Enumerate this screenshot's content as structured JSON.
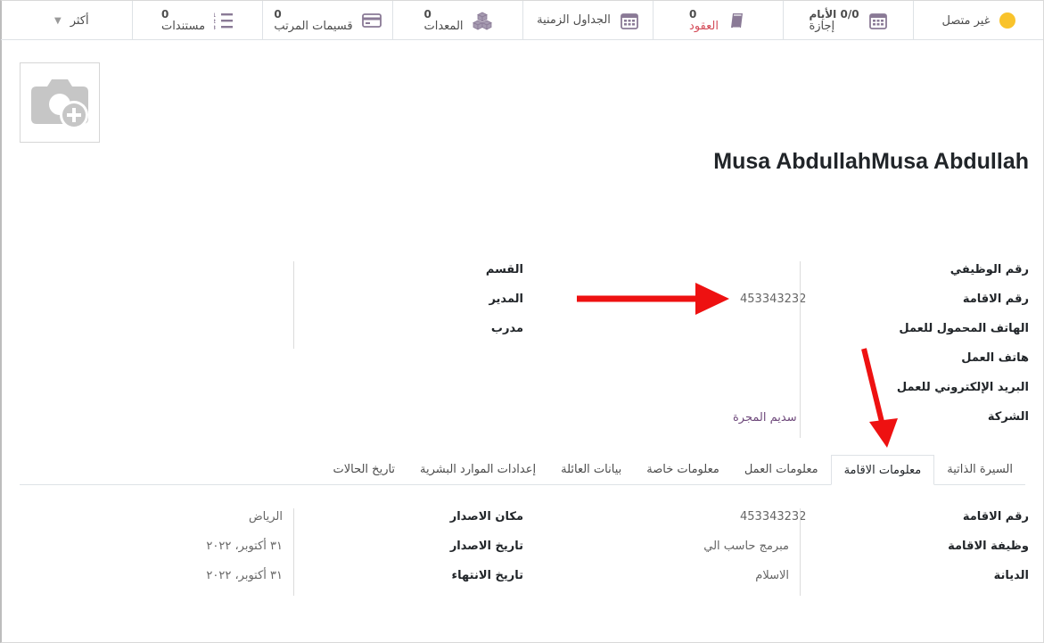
{
  "statbar": {
    "status": {
      "label": "غير متصل",
      "color": "#f9c32b"
    },
    "leave": {
      "num": "0/0 الأيام",
      "label": "إجازة"
    },
    "contracts": {
      "num": "0",
      "label": "العقود",
      "label_color": "#d44c59"
    },
    "timesheets": {
      "label": "الجداول الزمنية"
    },
    "equipment": {
      "num": "0",
      "label": "المعدات"
    },
    "payslips": {
      "num": "0",
      "label": "قسيمات المرتب"
    },
    "documents": {
      "num": "0",
      "label": "مستندات"
    },
    "more": {
      "label": "أكثر"
    }
  },
  "employee": {
    "name": "Musa AbdullahMusa Abdullah"
  },
  "info": {
    "right": [
      {
        "label": "رقم الوظيفي",
        "value": ""
      },
      {
        "label": "رقم الاقامة",
        "value": "453343232"
      },
      {
        "label": "الهاتف المحمول للعمل",
        "value": ""
      },
      {
        "label": "هاتف العمل",
        "value": ""
      },
      {
        "label": "البريد الإلكتروني للعمل",
        "value": ""
      },
      {
        "label": "الشركة",
        "value": "سديم المجرة"
      }
    ],
    "left": [
      {
        "label": "القسم",
        "value": ""
      },
      {
        "label": "المدير",
        "value": ""
      },
      {
        "label": "مدرب",
        "value": ""
      }
    ]
  },
  "tabs": [
    {
      "label": "السيرة الذاتية",
      "active": false
    },
    {
      "label": "معلومات الاقامة",
      "active": true
    },
    {
      "label": "معلومات العمل",
      "active": false
    },
    {
      "label": "معلومات خاصة",
      "active": false
    },
    {
      "label": "بيانات العائلة",
      "active": false
    },
    {
      "label": "إعدادات الموارد البشرية",
      "active": false
    },
    {
      "label": "تاريخ الحالات",
      "active": false
    }
  ],
  "residence": {
    "right": [
      {
        "label": "رقم الاقامة",
        "value": "453343232"
      },
      {
        "label": "وظيفة الاقامة",
        "value": "مبرمج حاسب الي"
      },
      {
        "label": "الديانة",
        "value": "الاسلام"
      }
    ],
    "left": [
      {
        "label": "مكان الاصدار",
        "value": "الرياض"
      },
      {
        "label": "تاريخ الاصدار",
        "value": "٣١ أكتوبر، ٢٠٢٢"
      },
      {
        "label": "تاريخ الانتهاء",
        "value": "٣١ أكتوبر، ٢٠٢٢"
      }
    ]
  },
  "colors": {
    "accent": "#6f4a7c",
    "danger": "#d44c59",
    "annotation_arrow": "#ee1111"
  }
}
